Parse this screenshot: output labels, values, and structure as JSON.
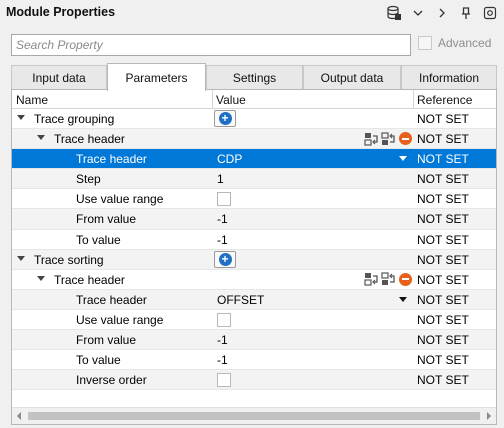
{
  "window": {
    "title": "Module Properties",
    "icons": [
      "database-icon",
      "chevron-down-icon",
      "chevron-right-icon",
      "pin-icon",
      "settings-icon"
    ]
  },
  "search": {
    "placeholder": "Search Property",
    "value": ""
  },
  "advanced": {
    "label": "Advanced",
    "checked": false
  },
  "tabs": [
    "Input data",
    "Parameters",
    "Settings",
    "Output data",
    "Information"
  ],
  "active_tab": "Parameters",
  "grid": {
    "headers": {
      "name": "Name",
      "value": "Value",
      "reference": "Reference"
    },
    "rows": [
      {
        "name": "Trace grouping",
        "level": 0,
        "expand": true,
        "value": "",
        "widget": "add",
        "ref": "NOT SET"
      },
      {
        "name": "Trace header",
        "level": 1,
        "expand": true,
        "value": "",
        "widget": "tools",
        "ref": "NOT SET"
      },
      {
        "name": "Trace header",
        "level": 2,
        "value": "CDP",
        "widget": "dropdown",
        "ref": "NOT SET",
        "selected": true
      },
      {
        "name": "Step",
        "level": 2,
        "value": "1",
        "widget": "text",
        "ref": "NOT SET"
      },
      {
        "name": "Use value range",
        "level": 2,
        "value": "",
        "widget": "checkbox",
        "ref": "NOT SET"
      },
      {
        "name": "From value",
        "level": 2,
        "value": "-1",
        "widget": "text",
        "ref": "NOT SET"
      },
      {
        "name": "To value",
        "level": 2,
        "value": "-1",
        "widget": "text",
        "ref": "NOT SET"
      },
      {
        "name": "Trace sorting",
        "level": 0,
        "expand": true,
        "value": "",
        "widget": "add",
        "ref": "NOT SET"
      },
      {
        "name": "Trace header",
        "level": 1,
        "expand": true,
        "value": "",
        "widget": "tools",
        "ref": "NOT SET"
      },
      {
        "name": "Trace header",
        "level": 2,
        "value": "OFFSET",
        "widget": "dropdown",
        "ref": "NOT SET"
      },
      {
        "name": "Use value range",
        "level": 2,
        "value": "",
        "widget": "checkbox",
        "ref": "NOT SET"
      },
      {
        "name": "From value",
        "level": 2,
        "value": "-1",
        "widget": "text",
        "ref": "NOT SET"
      },
      {
        "name": "To value",
        "level": 2,
        "value": "-1",
        "widget": "text",
        "ref": "NOT SET"
      },
      {
        "name": "Inverse order",
        "level": 2,
        "value": "",
        "widget": "checkbox",
        "ref": "NOT SET"
      }
    ]
  },
  "colors": {
    "selection": "#0078d7",
    "add": "#1f6fc4",
    "remove": "#e8601c"
  }
}
